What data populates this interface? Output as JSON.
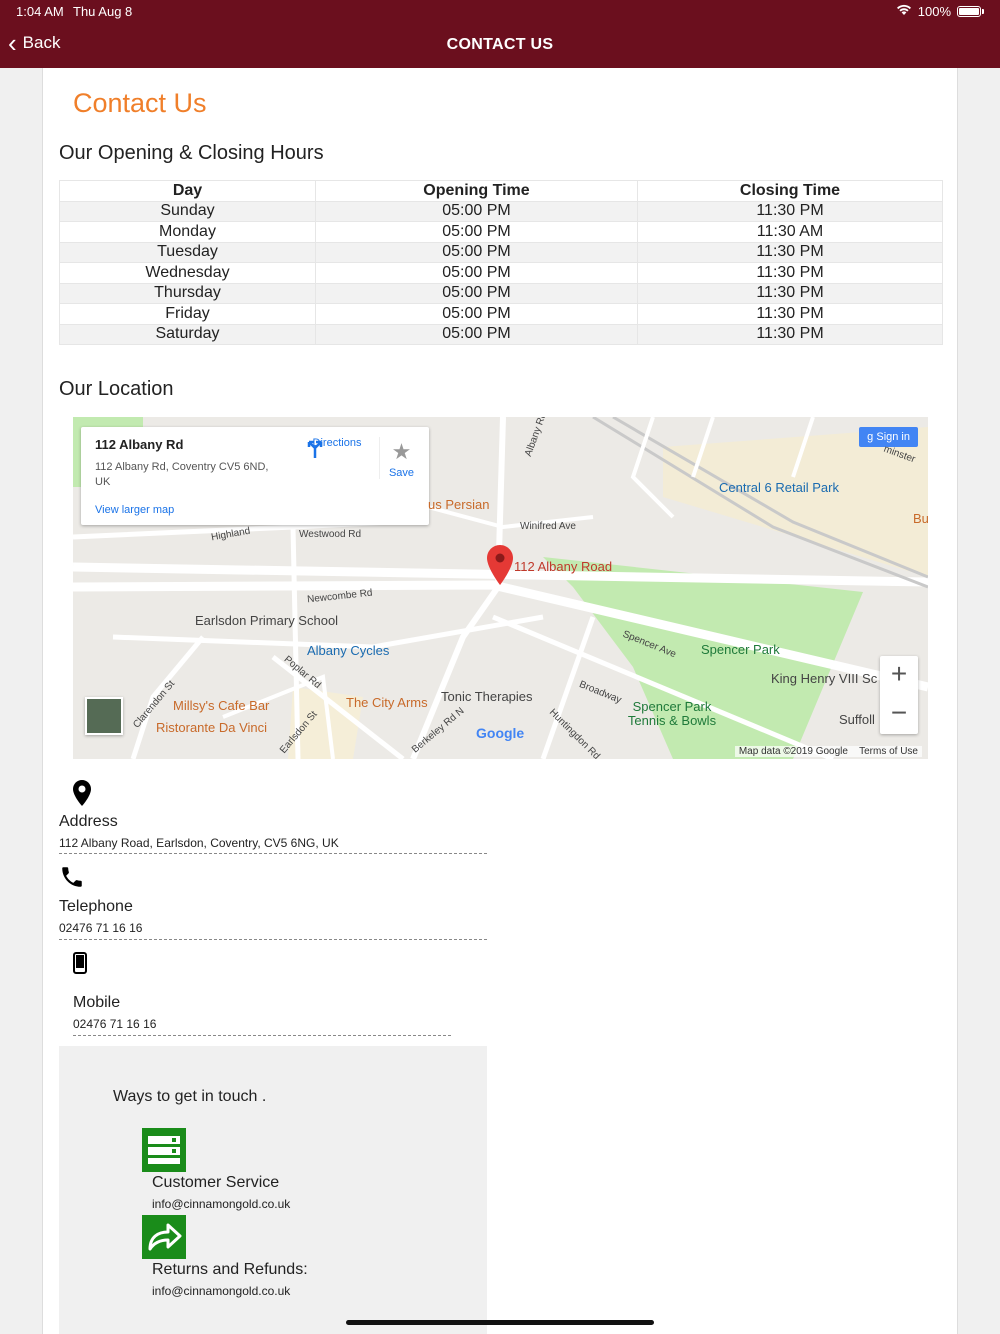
{
  "status": {
    "time": "1:04 AM",
    "date": "Thu Aug 8",
    "battery": "100%"
  },
  "nav": {
    "back_label": "Back",
    "title": "CONTACT US"
  },
  "page": {
    "title": "Contact Us",
    "hours_heading": "Our Opening & Closing Hours",
    "location_heading": "Our Location"
  },
  "hours": {
    "headers": [
      "Day",
      "Opening Time",
      "Closing Time"
    ],
    "rows": [
      [
        "Sunday",
        "05:00 PM",
        "11:30 PM"
      ],
      [
        "Monday",
        "05:00 PM",
        "11:30 AM"
      ],
      [
        "Tuesday",
        "05:00 PM",
        "11:30 PM"
      ],
      [
        "Wednesday",
        "05:00 PM",
        "11:30 PM"
      ],
      [
        "Thursday",
        "05:00 PM",
        "11:30 PM"
      ],
      [
        "Friday",
        "05:00 PM",
        "11:30 PM"
      ],
      [
        "Saturday",
        "05:00 PM",
        "11:30 PM"
      ]
    ]
  },
  "map": {
    "card_title": "112 Albany Rd",
    "card_address": "112 Albany Rd, Coventry CV5 6ND, UK",
    "directions": "Directions",
    "save": "Save",
    "view_larger": "View larger map",
    "sign_in": "Sign in",
    "pin_label": "112 Albany Road",
    "attribution": "Map data ©2019 Google",
    "terms": "Terms of Use",
    "google": "Google",
    "places": {
      "central6": "Central 6 Retail Park",
      "persian": "us Persian",
      "school": "Earlsdon Primary School",
      "cycles": "Albany Cycles",
      "spencer_park": "Spencer Park",
      "king_henry": "King Henry VIII Sc",
      "millys": "Millsy's Cafe Bar",
      "city_arms": "The City Arms",
      "tonic": "Tonic Therapies",
      "bowls": "Spencer Park Tennis & Bowls",
      "suffolk": "Suffoll",
      "da_vinci": "Ristorante Da Vinci",
      "bu": "Bu"
    },
    "streets": {
      "highland": "Highland",
      "westwood": "Westwood Rd",
      "winifred": "Winifred Ave",
      "newcombe": "Newcombe Rd",
      "spencer_ave": "Spencer Ave",
      "broadway": "Broadway",
      "poplar": "Poplar Rd",
      "clarendon": "Clarendon St",
      "earlsdon_st": "Earlsdon St",
      "berkeley": "Berkeley Rd N",
      "huntingdon": "Huntingdon Rd",
      "albany": "Albany Rd",
      "minster": "minster"
    }
  },
  "contact": {
    "address_label": "Address",
    "address_value": "112 Albany Road, Earlsdon, Coventry, CV5 6NG, UK",
    "phone_label": "Telephone",
    "phone_value": "02476 71 16 16",
    "mobile_label": "Mobile",
    "mobile_value": "02476 71 16 16"
  },
  "touch": {
    "intro": "Ways to get in touch .",
    "service_label": "Customer Service",
    "service_email": "info@cinnamongold.co.uk",
    "refunds_label": "Returns and Refunds:",
    "refunds_email": "info@cinnamongold.co.uk"
  },
  "colors": {
    "nav_bg": "#6b0f1e",
    "accent": "#f07f2a",
    "button_green": "#1a8c1a",
    "map_park": "#c2eab0"
  }
}
